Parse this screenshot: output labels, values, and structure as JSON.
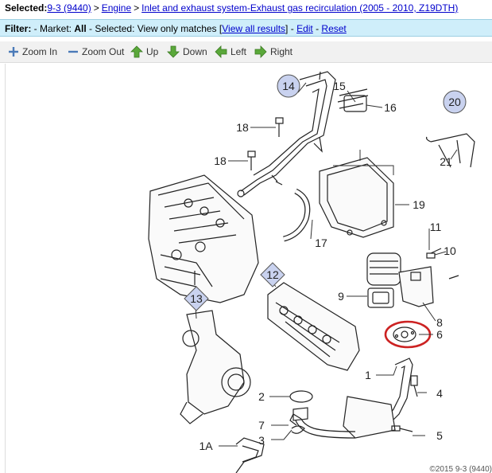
{
  "breadcrumb": {
    "selected_label": "Selected:",
    "model": "9-3 (9440)",
    "sep": ">",
    "engine": "Engine",
    "system": "Inlet and exhaust system-Exhaust gas recirculation (2005 - 2010, Z19DTH)"
  },
  "filter": {
    "label": "Filter:",
    "market_text": " - Market: ",
    "market_value": "All",
    "selected_text": " - Selected: ",
    "selected_value": "View only matches",
    "view_all": "View all results",
    "dash1": " - ",
    "edit": "Edit",
    "dash2": " - ",
    "reset": "Reset"
  },
  "toolbar": {
    "zoom_in": "Zoom In",
    "zoom_out": "Zoom Out",
    "up": "Up",
    "down": "Down",
    "left": "Left",
    "right": "Right"
  },
  "callouts": {
    "c1": "1",
    "c1a": "1A",
    "c2": "2",
    "c3": "3",
    "c4": "4",
    "c5": "5",
    "c6": "6",
    "c7": "7",
    "c8": "8",
    "c9": "9",
    "c10": "10",
    "c11": "11",
    "c12": "12",
    "c13": "13",
    "c14": "14",
    "c15": "15",
    "c16": "16",
    "c17": "17",
    "c18a": "18",
    "c18b": "18",
    "c19": "19",
    "c20": "20",
    "c21": "21"
  },
  "copyright": "©2015 9-3 (9440)",
  "colors": {
    "highlight_ring": "#cc2222",
    "callout_fill": "#c9d2ef",
    "filter_bg": "#cfeefa"
  }
}
